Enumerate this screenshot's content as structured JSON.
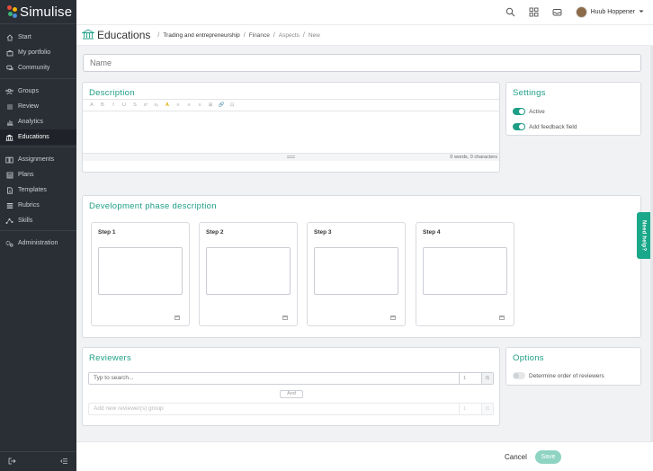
{
  "app": {
    "brand": "Simulise"
  },
  "sidebar": {
    "group1": [
      {
        "label": "Start",
        "icon": "home-icon"
      },
      {
        "label": "My portfolio",
        "icon": "briefcase-icon"
      },
      {
        "label": "Community",
        "icon": "chat-icon"
      }
    ],
    "group2": [
      {
        "label": "Groups",
        "icon": "users-icon"
      },
      {
        "label": "Review",
        "icon": "list-icon"
      },
      {
        "label": "Analytics",
        "icon": "bar-chart-icon"
      },
      {
        "label": "Educations",
        "icon": "institution-icon",
        "active": true
      }
    ],
    "group3": [
      {
        "label": "Assignments",
        "icon": "book-icon"
      },
      {
        "label": "Plans",
        "icon": "grid-icon"
      },
      {
        "label": "Templates",
        "icon": "file-icon"
      },
      {
        "label": "Rubrics",
        "icon": "rows-icon"
      },
      {
        "label": "Skills",
        "icon": "graph-icon"
      }
    ],
    "group4": [
      {
        "label": "Administration",
        "icon": "cogs-icon"
      }
    ]
  },
  "topbar": {
    "user_name": "Huub Hoppener"
  },
  "breadcrumb": {
    "title": "Educations",
    "items": [
      "Trading and entrepreneurship",
      "Finance",
      "Aspects",
      "New"
    ]
  },
  "form": {
    "name_placeholder": "Name",
    "description": {
      "title": "Description",
      "word_count": "0 words, 0 characters",
      "toolbar": [
        "A",
        "B",
        "I",
        "U",
        "S",
        "x²",
        "x₂",
        "A",
        "≡",
        "≡",
        "≡",
        "⊞",
        "🔗",
        "⊡"
      ]
    },
    "settings": {
      "title": "Settings",
      "toggles": [
        {
          "label": "Active",
          "on": true
        },
        {
          "label": "Add feedback field",
          "on": true
        }
      ]
    },
    "development": {
      "title": "Development phase description",
      "steps": [
        "Step 1",
        "Step 2",
        "Step 3",
        "Step 4"
      ]
    },
    "reviewers": {
      "title": "Reviewers",
      "search_placeholder": "Typ to search...",
      "seg_value": "1",
      "seg_suffix": "/1",
      "and_label": "And",
      "add_group_placeholder": "Add new reviewer(s) group"
    },
    "options": {
      "title": "Options",
      "toggles": [
        {
          "label": "Determine order of reviewers",
          "on": false
        }
      ]
    }
  },
  "footer": {
    "cancel_label": "Cancel",
    "save_label": "Save"
  },
  "help_label": "Need help?",
  "colors": {
    "accent": "#1e9e86",
    "sidebar_bg": "#2a2f36",
    "save_disabled": "#8fd3c3"
  }
}
